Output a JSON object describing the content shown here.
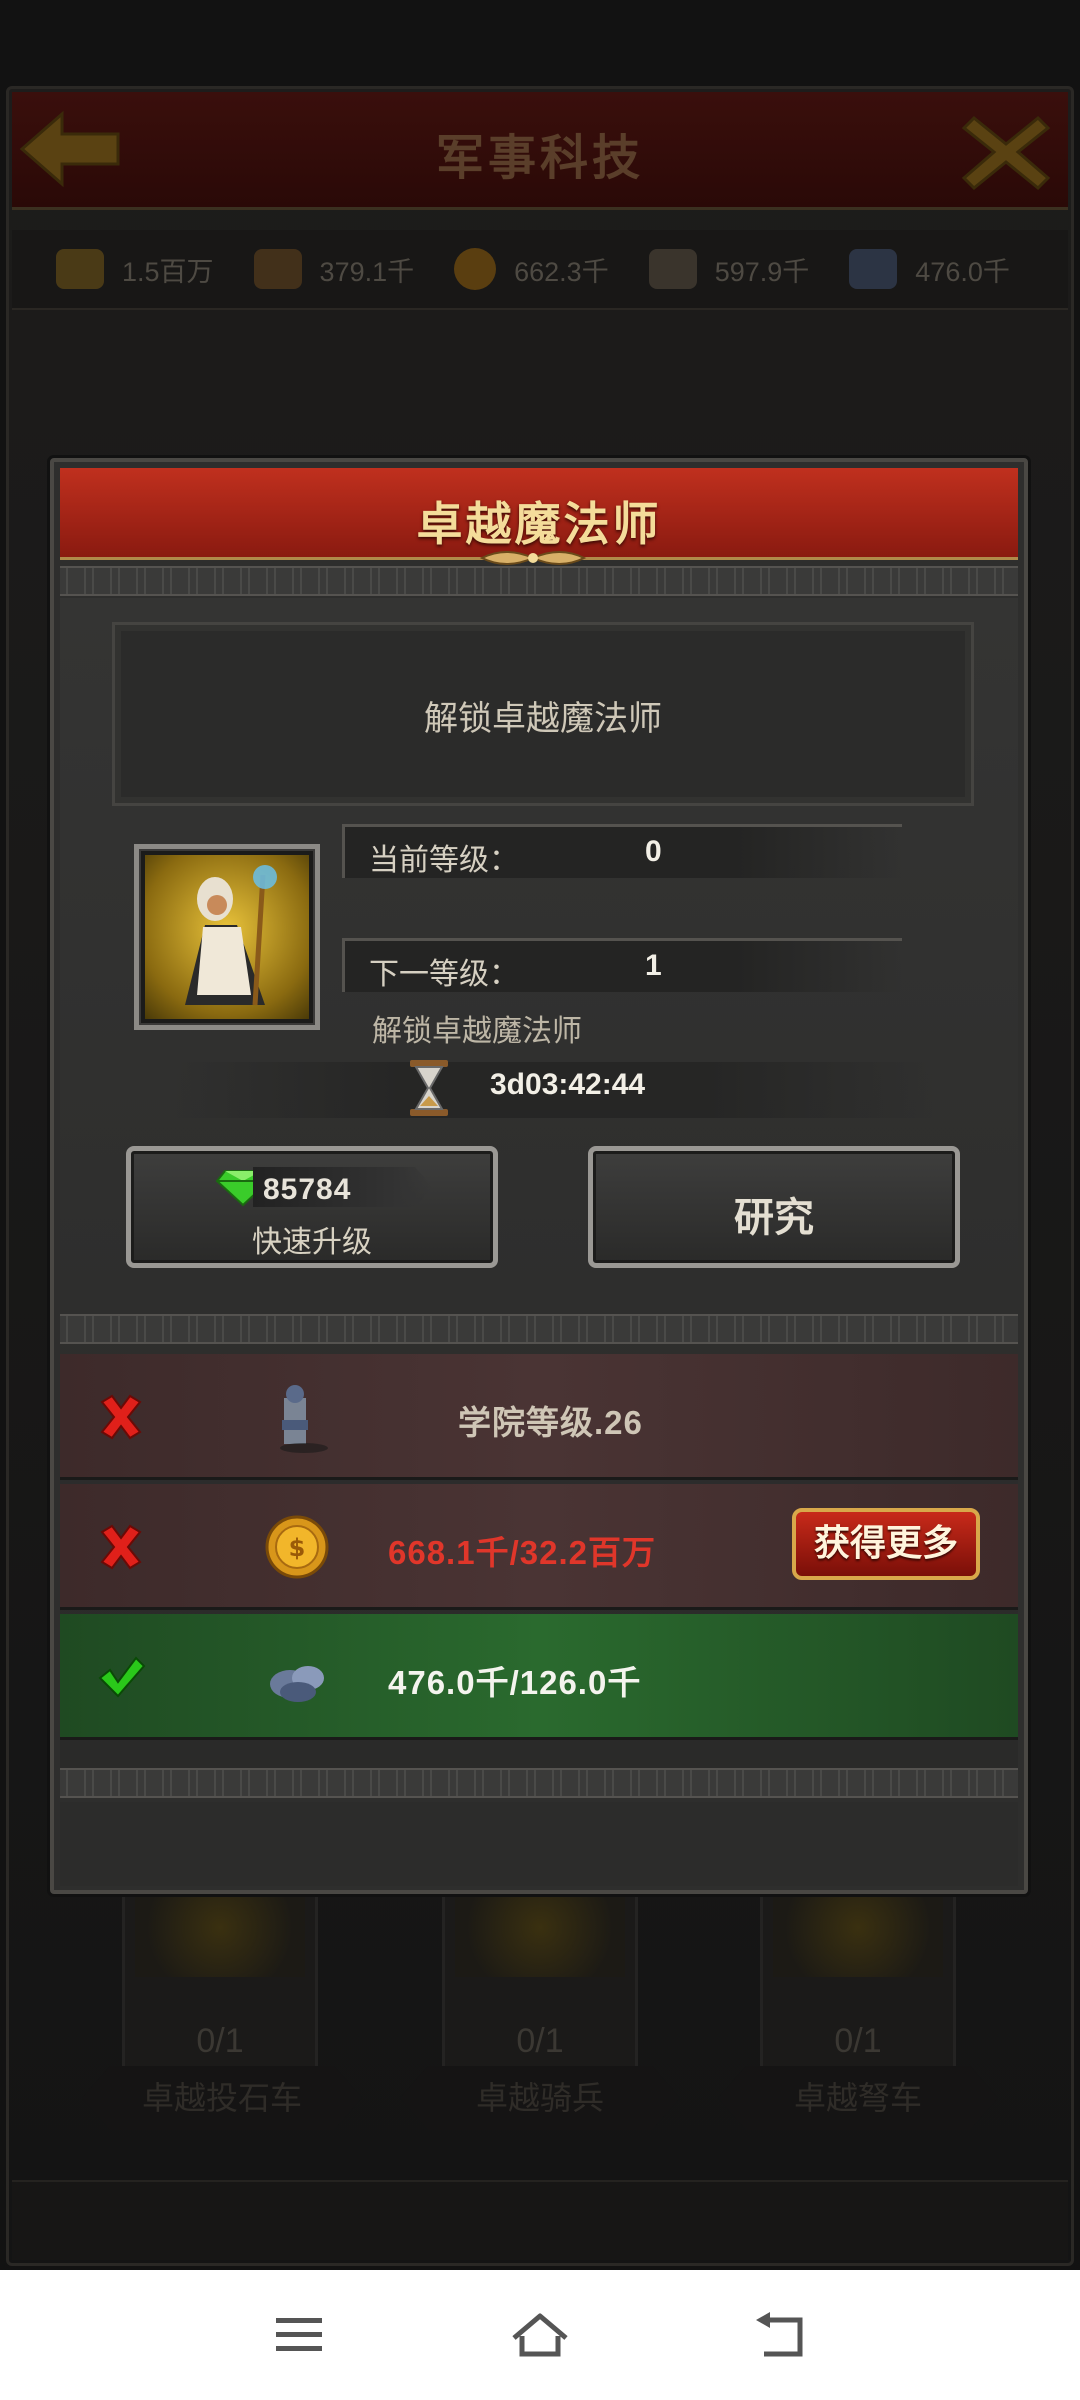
{
  "background": {
    "title": "军事科技",
    "resources": [
      {
        "icon": "wood-icon",
        "value": "1.5百万",
        "color": "#9a7a2a"
      },
      {
        "icon": "food-icon",
        "value": "379.1千",
        "color": "#8a5a22"
      },
      {
        "icon": "gold-coin-icon",
        "value": "662.3千",
        "color": "#d49a1a"
      },
      {
        "icon": "stone-icon",
        "value": "597.9千",
        "color": "#7a6a55"
      },
      {
        "icon": "iron-ore-icon",
        "value": "476.0千",
        "color": "#5a6a8a"
      }
    ],
    "cards": [
      {
        "count": "0/1",
        "label": "卓越投石车"
      },
      {
        "count": "0/1",
        "label": "卓越骑兵"
      },
      {
        "count": "0/1",
        "label": "卓越弩车"
      }
    ]
  },
  "dialog": {
    "title": "卓越魔法师",
    "description": "解锁卓越魔法师",
    "current_level_label": "当前等级：",
    "current_level_value": "0",
    "next_level_label": "下一等级：",
    "next_level_value": "1",
    "next_level_desc": "解锁卓越魔法师",
    "timer": "3d03:42:44",
    "quick_upgrade": {
      "gem_cost": "85784",
      "label": "快速升级"
    },
    "research_label": "研究",
    "requirements": [
      {
        "status": "fail",
        "icon": "academy-icon",
        "text": "学院等级.26",
        "text_color": "#cfc6b6"
      },
      {
        "status": "fail",
        "icon": "gold-coin-icon",
        "text": "668.1千/32.2百万",
        "text_color": "#e0362a",
        "action": "获得更多"
      },
      {
        "status": "ok",
        "icon": "iron-ore-icon",
        "text": "476.0千/126.0千",
        "text_color": "#f4f4ee"
      }
    ]
  },
  "colors": {
    "header_red": "#b0281a",
    "accent_gold": "#f4dc9a",
    "fail_red": "#e0362a",
    "ok_green": "#2a6a2e"
  }
}
